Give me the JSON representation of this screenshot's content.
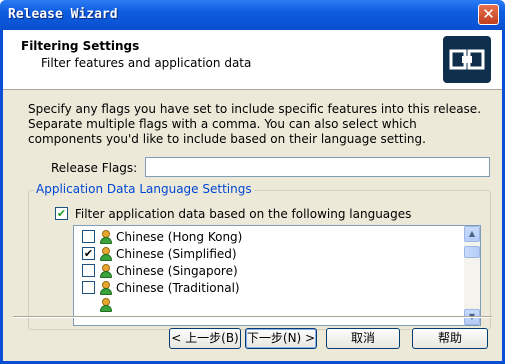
{
  "window": {
    "title": "Release Wizard",
    "close": "✕"
  },
  "header": {
    "title": "Filtering Settings",
    "subtitle": "Filter features and application data",
    "logo": "release-logo-icon"
  },
  "description": "Specify any flags you have set to include specific features into this release. Separate multiple flags with a comma. You can also select which components you'd like to include based on their language setting.",
  "release_flags": {
    "label": "Release Flags:",
    "value": ""
  },
  "language_group": {
    "legend": "Application Data Language Settings",
    "filter_checkbox": {
      "label": "Filter application data based on the following languages",
      "checked": true
    },
    "languages": [
      {
        "label": "Chinese (Hong Kong)",
        "checked": false
      },
      {
        "label": "Chinese (Simplified)",
        "checked": true
      },
      {
        "label": "Chinese (Singapore)",
        "checked": false
      },
      {
        "label": "Chinese (Traditional)",
        "checked": false
      }
    ]
  },
  "buttons": {
    "back": "< 上一步(B)",
    "next": "下一步(N) >",
    "cancel": "取消",
    "help": "帮助"
  },
  "colors": {
    "titlebar": "#0a4fd6",
    "legend": "#0046d5",
    "logo": "#0f2f4d"
  }
}
